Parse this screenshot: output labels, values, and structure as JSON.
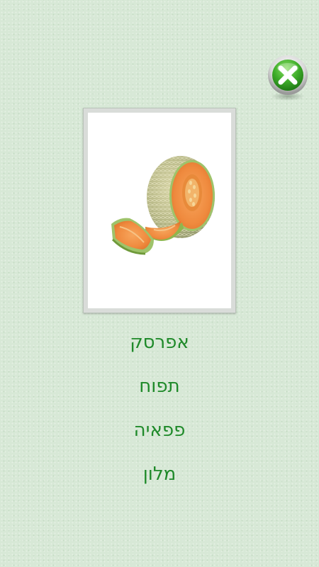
{
  "close_button": {
    "icon": "close-icon",
    "colors": {
      "green": "#3fae2a",
      "ring": "#d8d8d8",
      "x": "#ffffff"
    }
  },
  "picture": {
    "subject_icon": "cantaloupe-melon-image"
  },
  "options": [
    {
      "label": "אפרסק"
    },
    {
      "label": "תפוח"
    },
    {
      "label": "פפאיה"
    },
    {
      "label": "מלון"
    }
  ],
  "colors": {
    "background": "#d7e8d6",
    "option_text": "#1f8a2a"
  }
}
